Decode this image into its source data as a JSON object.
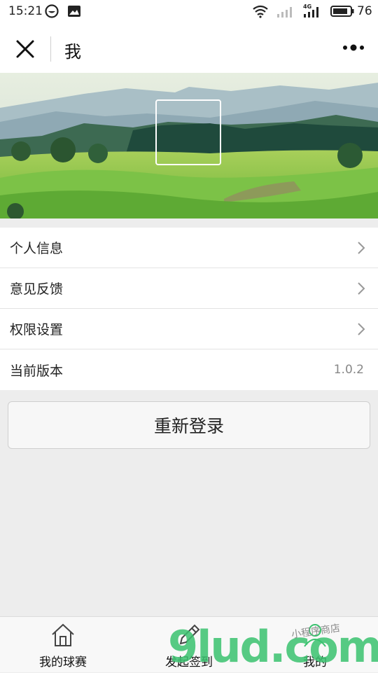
{
  "status_bar": {
    "time": "15:21",
    "battery": "76",
    "network_label": "4G"
  },
  "title_bar": {
    "title": "我"
  },
  "menu": {
    "items": [
      {
        "label": "个人信息"
      },
      {
        "label": "意见反馈"
      },
      {
        "label": "权限设置"
      },
      {
        "label": "当前版本",
        "value": "1.0.2"
      }
    ]
  },
  "relogin_button": {
    "label": "重新登录"
  },
  "tab_bar": {
    "tabs": [
      {
        "label": "我的球赛",
        "icon": "home-icon"
      },
      {
        "label": "发起签到",
        "icon": "pencil-icon"
      },
      {
        "label": "我的",
        "icon": "person-icon"
      }
    ]
  },
  "watermark": {
    "text": "9lud.com",
    "subtext": "小程序商店"
  },
  "colors": {
    "page_bg": "#ededed",
    "white": "#ffffff",
    "watermark_green": "#3ac26e",
    "watermark_orange": "#f2a31a"
  }
}
